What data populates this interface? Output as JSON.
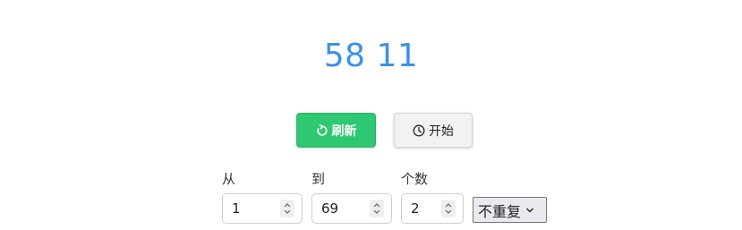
{
  "result": {
    "text": "58 11"
  },
  "buttons": {
    "refresh_label": "刷新",
    "start_label": "开始"
  },
  "form": {
    "from": {
      "label": "从",
      "value": "1"
    },
    "to": {
      "label": "到",
      "value": "69"
    },
    "count": {
      "label": "个数",
      "value": "2"
    },
    "mode": {
      "selected": "不重复"
    }
  },
  "colors": {
    "result": "#3b92e8",
    "refresh_bg": "#2ec772",
    "start_bg": "#f2f2f2"
  },
  "icons": {
    "refresh": "refresh-icon",
    "start": "clock-icon",
    "select": "chevron-down-icon",
    "spinner": "spinner-arrows-icon"
  }
}
